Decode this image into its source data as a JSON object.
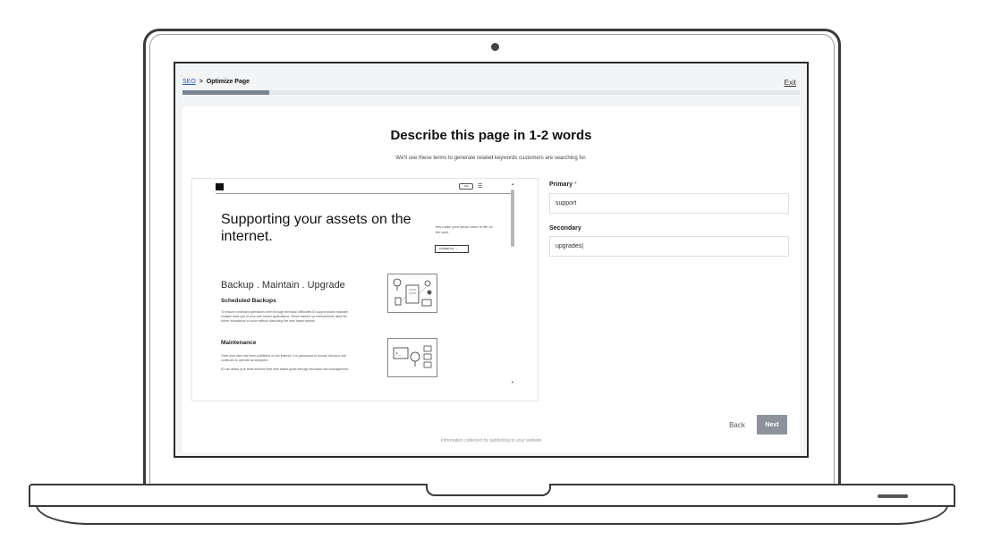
{
  "header": {
    "breadcrumb_root": "SEO",
    "breadcrumb_separator": ">",
    "breadcrumb_current": "Optimize Page",
    "exit_label": "Exit",
    "progress_fraction": 0.14
  },
  "main": {
    "title": "Describe this page in 1-2 words",
    "subtitle": "We'll use these terms to generate related keywords customers are searching for."
  },
  "preview": {
    "hero_title": "Supporting your assets on the internet.",
    "cta_text": "lets make your ideas come to life on the web.",
    "cta_button": "contact us",
    "nav_pill": "call",
    "menu_icon": "hamburger-icon",
    "tagline": "Backup . Maintain . Upgrade",
    "section1_heading": "Scheduled Backups",
    "section1_text": "To ensure continued operations even through technical difficulties ID support plans maintain multiple back ups of your web based applications. These backed up environments allow for future innovations to occur without disturbing live web based assets.",
    "section2_heading": "Maintenance",
    "section2_text": "Once your idea has been published on the internet, it is paramount to ensure that your site continues to operate as designed.",
    "section2_text2": "ID can assist your team achieve their web based goals through education and management."
  },
  "form": {
    "primary_label": "Primary",
    "primary_required_mark": "*",
    "primary_value": "support",
    "secondary_label": "Secondary",
    "secondary_value": "upgrades|"
  },
  "actions": {
    "back_label": "Back",
    "next_label": "Next"
  },
  "footer": {
    "note": "Information collected for publishing to your website"
  },
  "colors": {
    "link": "#2a5db0",
    "progress_fill": "#7a8594",
    "next_button": "#8c939c"
  }
}
